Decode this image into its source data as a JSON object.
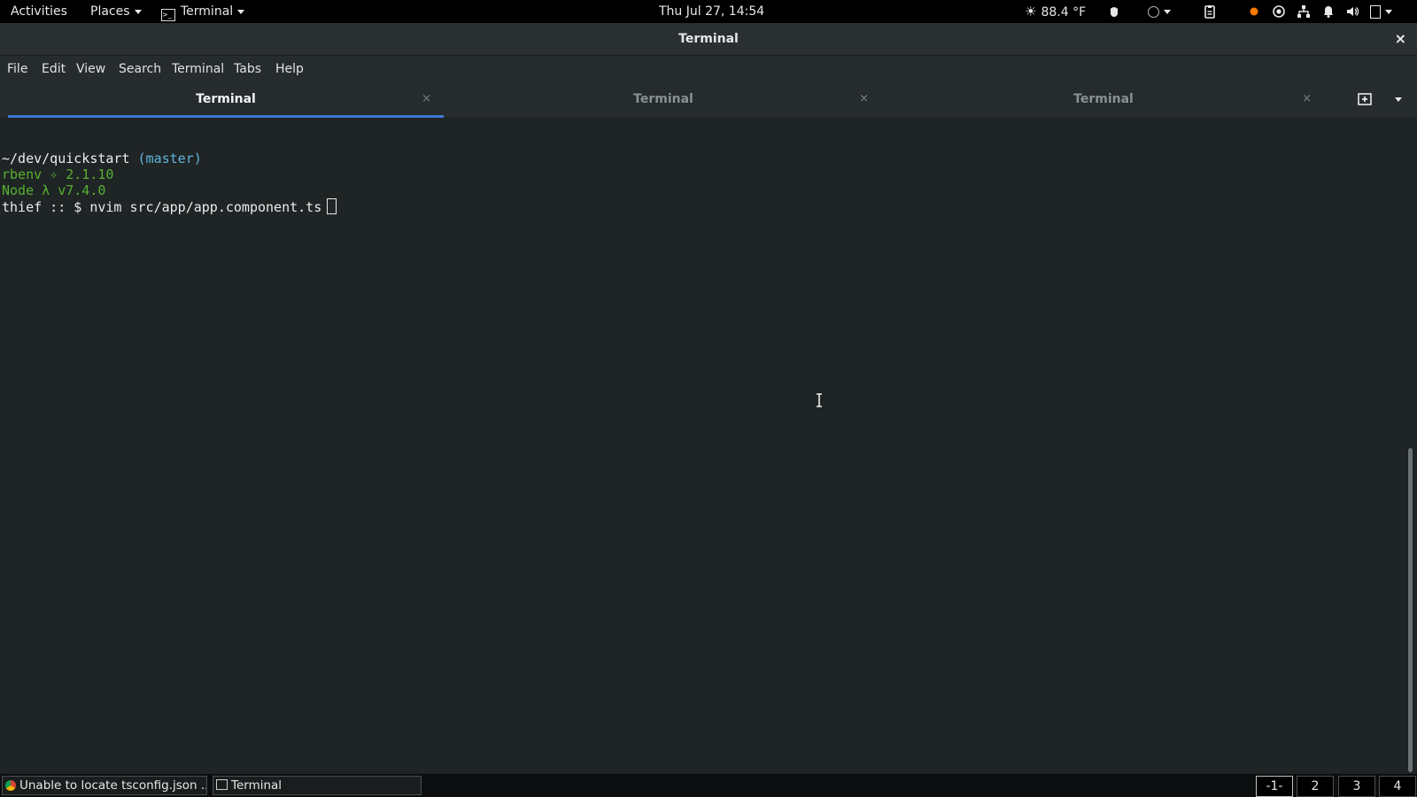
{
  "topbar": {
    "activities": "Activities",
    "places": "Places",
    "app_menu": "Terminal",
    "clock": "Thu Jul 27, 14:54",
    "weather": "88.4 °F",
    "icons": [
      "weather-sun-icon",
      "hand-icon",
      "circle-indicator-icon",
      "clipboard-icon",
      "record-dot-icon",
      "target-icon",
      "network-icon",
      "notifications-icon",
      "volume-icon",
      "battery-icon"
    ],
    "accent_dot": "#ff7a00"
  },
  "window": {
    "title": "Terminal",
    "close": "×"
  },
  "menu": {
    "file": "File",
    "edit": "Edit",
    "view": "View",
    "search": "Search",
    "terminal": "Terminal",
    "tabs": "Tabs",
    "help": "Help"
  },
  "tabs": [
    {
      "label": "Terminal",
      "active": true
    },
    {
      "label": "Terminal",
      "active": false
    },
    {
      "label": "Terminal",
      "active": false
    }
  ],
  "tab_close": "×",
  "terminal": {
    "path": "~/dev/quickstart",
    "branch": "(master)",
    "rbenv": "rbenv ✧ 2.1.10",
    "node": "Node λ v7.4.0",
    "prompt": "thief :: $ nvim src/app/app.component.ts",
    "colors": {
      "text": "#e9ecec",
      "branch": "#5fb6dc",
      "green": "#56b12e"
    }
  },
  "taskbar": {
    "items": [
      {
        "label": "Unable to locate tsconfig.json ...",
        "icon": "chrome-icon"
      },
      {
        "label": "Terminal",
        "icon": "terminal-icon"
      }
    ],
    "workspaces": [
      "-1-",
      "2",
      "3",
      "4"
    ]
  }
}
